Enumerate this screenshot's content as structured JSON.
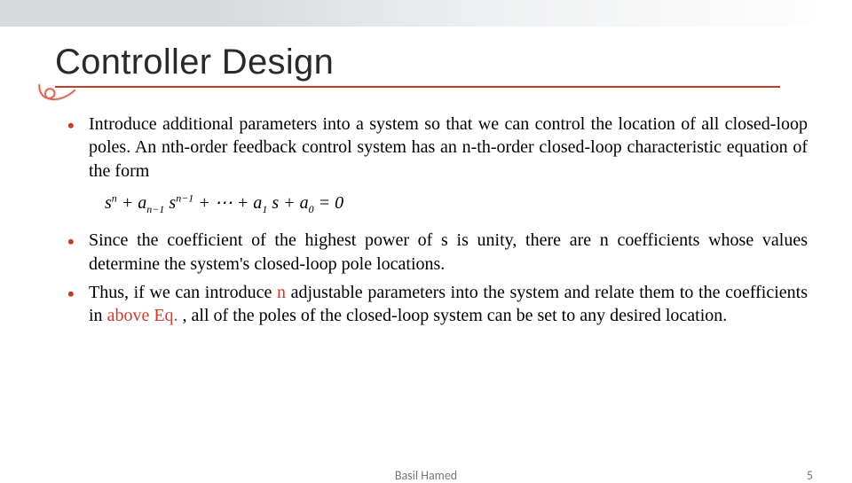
{
  "title": "Controller Design",
  "bullets": {
    "item1_text": "Introduce additional parameters into a system so that we can control the location of all closed-loop poles. An nth-order feedback control system has an n-th-order closed-loop characteristic equation of the form",
    "item2_text": "Since the coefficient of the highest power of s is unity, there are n coefficients whose values determine the system's closed-loop pole locations.",
    "item3_prefix": "Thus, if we can introduce ",
    "item3_red1": "n",
    "item3_mid": " adjustable parameters into the system and relate them to the coefficients in ",
    "item3_red2": "above Eq. ",
    "item3_suffix": ", all of the poles of the closed-loop system can be set to any desired location."
  },
  "equation": {
    "raw": "s^n + a_{n-1} s^{n-1} + \\u22ef + a_1 s + a_0 = 0",
    "display": {
      "t1": "s",
      "e1": "n",
      "t2": " + a",
      "s2": "n−1",
      "t3": " s",
      "e3": "n−1",
      "t4": " + ⋯ + a",
      "s4": "1",
      "t5": " s + a",
      "s5": "0",
      "t6": " = 0"
    }
  },
  "footer": {
    "author": "Basil Hamed",
    "page": "5"
  }
}
